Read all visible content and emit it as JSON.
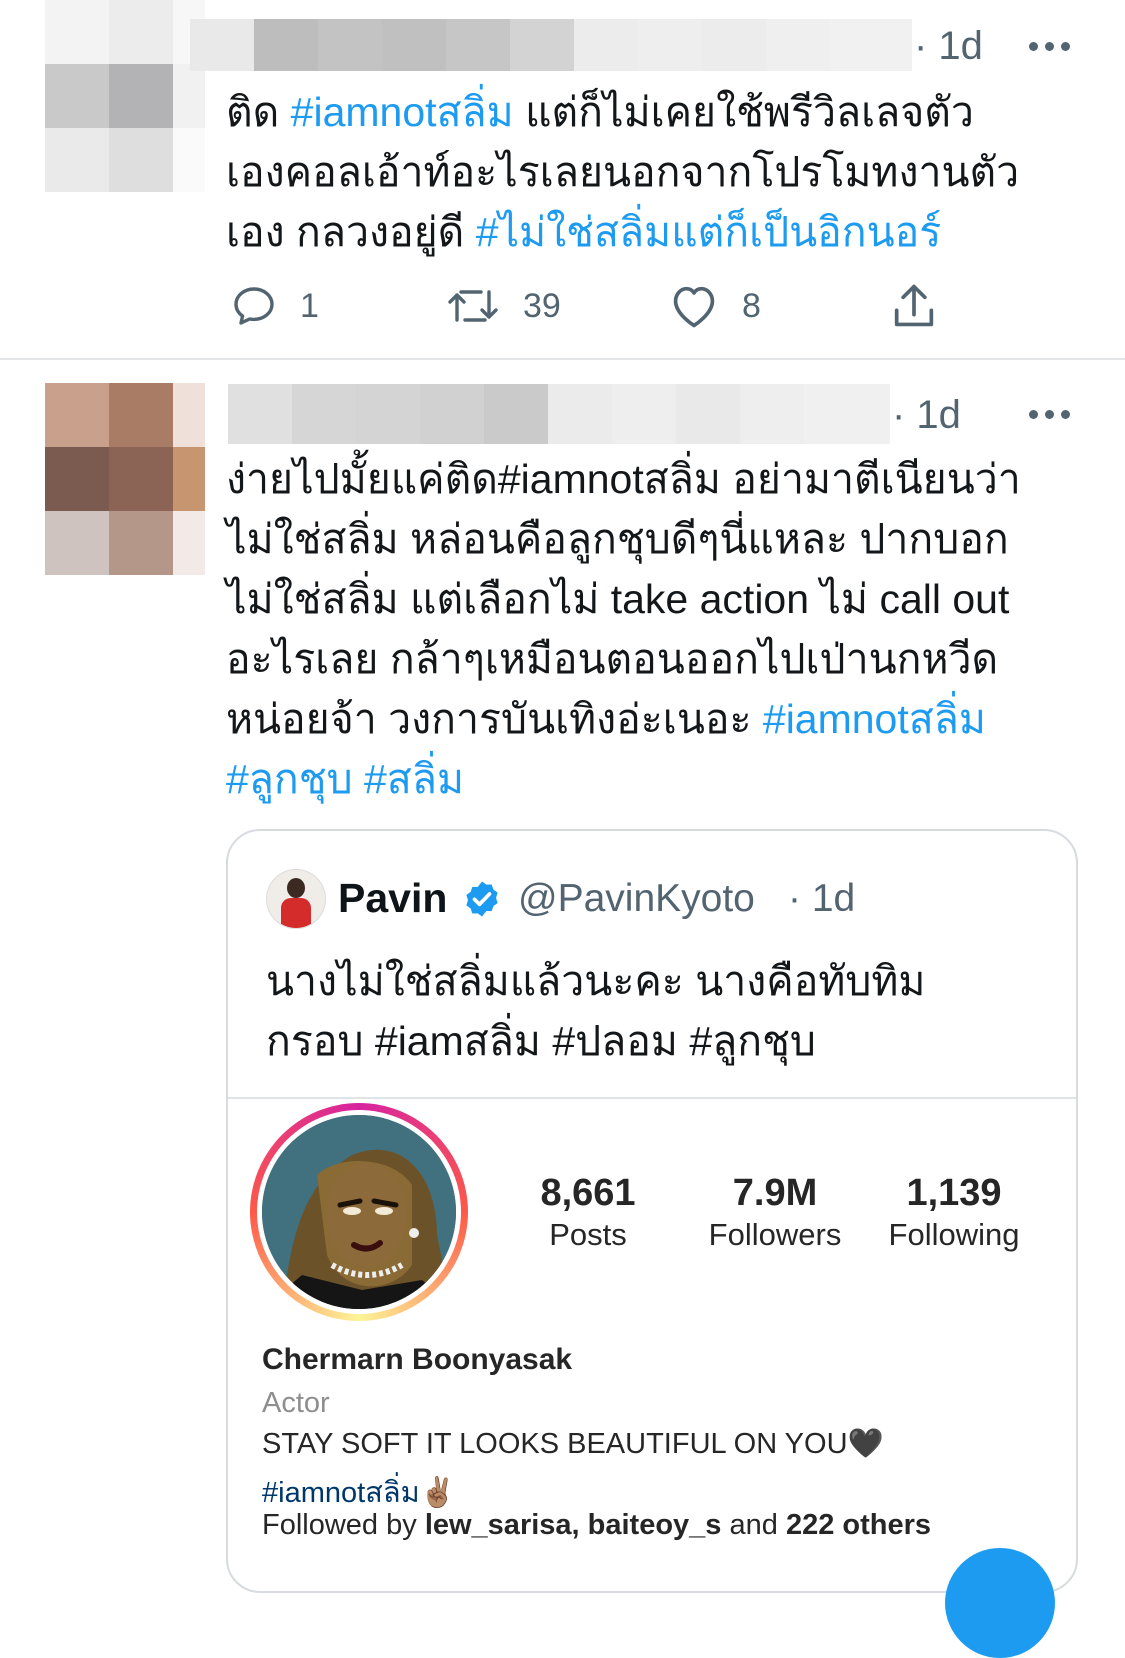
{
  "tweets": [
    {
      "time": "· 1d",
      "text_segments": [
        {
          "t": "ติด ",
          "tag": false
        },
        {
          "t": "#iamnotสลิ่ม",
          "tag": true
        },
        {
          "t": " แต่ก็ไม่เคยใช้พรีวิลเลจตัว\nเองคอลเอ้าท์อะไรเลยนอกจากโปรโมทงานตัว\nเอง กลวงอยู่ดี ",
          "tag": false
        },
        {
          "t": "#ไม่ใช่สลิ่มแต่ก็เป็นอิกนอร์",
          "tag": true
        }
      ],
      "reply_count": "1",
      "retweet_count": "39",
      "like_count": "8"
    },
    {
      "time": "· 1d",
      "text_segments": [
        {
          "t": "ง่ายไปมั้ยแค่ติด#iamnotสลิ่ม อย่ามาตีเนียนว่า\nไม่ใช่สลิ่ม หล่อนคือลูกชุบดีๆนี่แหละ ปากบอก\nไม่ใช่สลิ่ม แต่เลือกไม่ take action ไม่ call out\nอะไรเลย กล้าๆเหมือนตอนออกไปเป่านกหวีด\nหน่อยจ้า วงการบันเทิงอ่ะเนอะ ",
          "tag": false
        },
        {
          "t": "#iamnotสลิ่ม",
          "tag": true
        },
        {
          "t": "\n",
          "tag": false
        },
        {
          "t": "#ลูกชุบ #สลิ่ม",
          "tag": true
        }
      ]
    }
  ],
  "quote": {
    "name": "Pavin",
    "handle": "@PavinKyoto",
    "time": "· 1d",
    "text": "นางไม่ใช่สลิ่มแล้วนะคะ นางคือทับทิม\nกรอบ #iamสลิ่ม #ปลอม #ลูกชุบ"
  },
  "instagram": {
    "stats": [
      {
        "value": "8,661",
        "label": "Posts"
      },
      {
        "value": "7.9M",
        "label": "Followers"
      },
      {
        "value": "1,139",
        "label": "Following"
      }
    ],
    "name": "Chermarn Boonyasak",
    "category": "Actor",
    "bio_line": "STAY SOFT IT LOOKS BEAUTIFUL ON YOU🖤",
    "bio_tag": "#iamnotสลิ่ม",
    "bio_emoji": "✌🏽",
    "followed_prefix": "Followed by ",
    "followed_names": "lew_sarisa, baiteoy_s",
    "followed_mid": " and ",
    "followed_others": "222 others"
  },
  "colors": {
    "hashtag": "#1d9bf0",
    "muted": "#536471",
    "verified": "#1d9bf0"
  }
}
